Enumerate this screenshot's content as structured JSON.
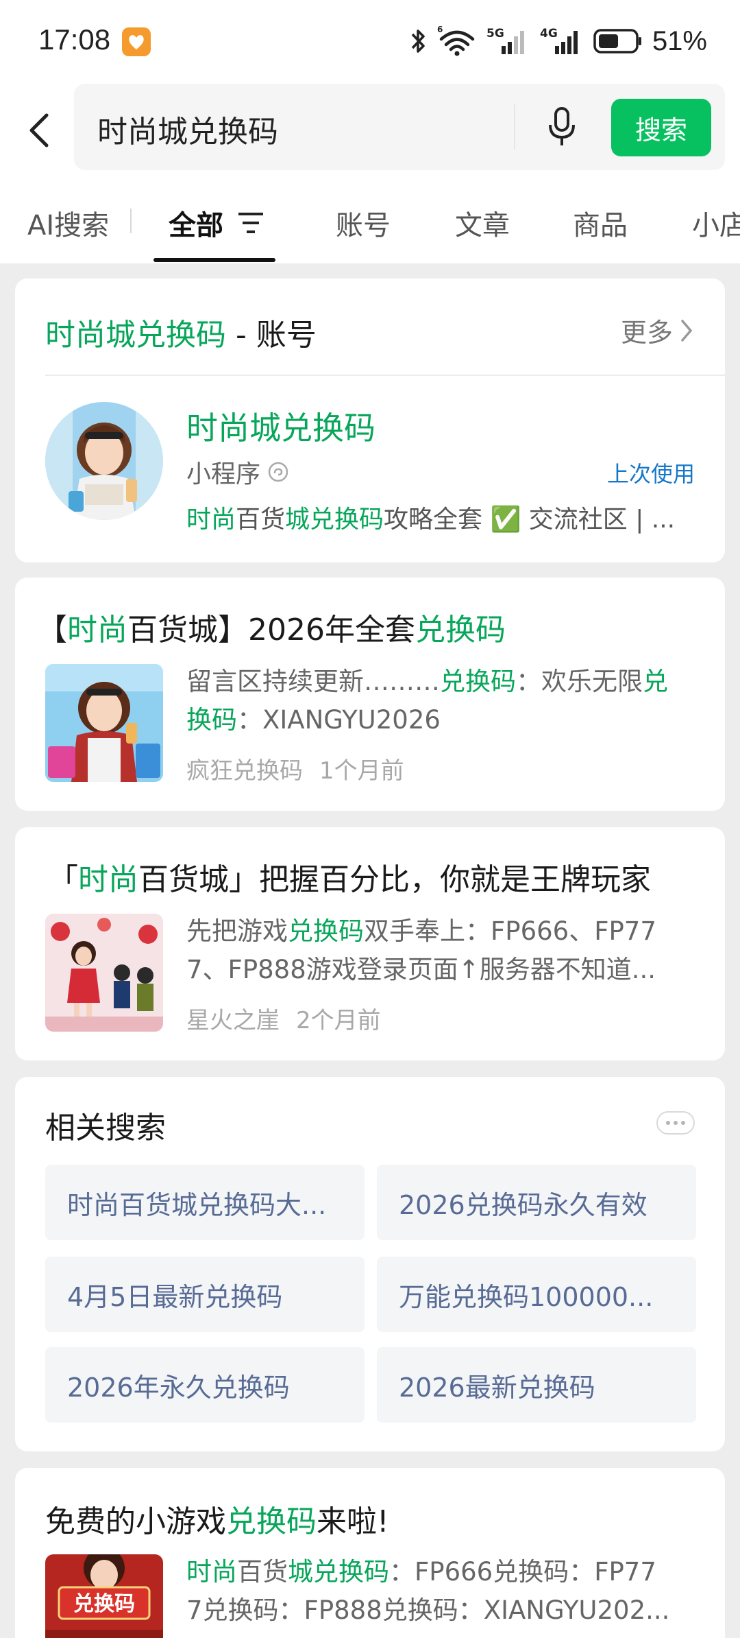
{
  "status_bar": {
    "time": "17:08",
    "network_5g": "5G",
    "network_4g": "4G",
    "wifi_badge": "6",
    "battery": "51%"
  },
  "search": {
    "query": "时尚城兑换码",
    "button": "搜索"
  },
  "tabs": [
    "AI搜索",
    "全部",
    "账号",
    "文章",
    "商品",
    "小店"
  ],
  "account_card": {
    "header_hl": "时尚城兑换码",
    "header_rest": " - 账号",
    "more": "更多",
    "name": "时尚城兑换码",
    "type": "小程序",
    "last_used": "上次使用",
    "desc_parts": [
      "时尚",
      "百货",
      "城兑换码",
      "攻略全套 ✅ 交流社区 | ..."
    ]
  },
  "results": [
    {
      "title_parts": [
        "【",
        "时尚",
        "百货城】2026年全套",
        "兑换码"
      ],
      "line1_parts": [
        "留言区持续更新………",
        "兑换码",
        "：欢乐无限",
        "兑"
      ],
      "line2_parts": [
        "换码",
        "：XIANGYU2026"
      ],
      "source": "疯狂兑换码",
      "time": "1个月前"
    },
    {
      "title_parts": [
        "「",
        "时尚",
        "百货城」把握百分比，你就是王牌玩家"
      ],
      "line1_parts": [
        "先把游戏",
        "兑换码",
        "双手奉上：FP666、FP77"
      ],
      "line2_parts": [
        "7、FP888游戏登录页面↑服务器不知道..."
      ],
      "source": "星火之崖",
      "time": "2个月前"
    },
    {
      "title_parts": [
        "免费的小游戏",
        "兑换码",
        "来啦!"
      ],
      "line1_parts": [
        "时尚",
        "百货",
        "城兑换码",
        "：FP666兑换码：FP77"
      ],
      "line2_parts": [
        "7兑换码：FP888兑换码：XIANGYU202..."
      ],
      "thumb_text": "兑换码"
    }
  ],
  "related": {
    "title": "相关搜索",
    "items": [
      "时尚百货城兑换码大...",
      "2026兑换码永久有效",
      "4月5日最新兑换码",
      "万能兑换码100000...",
      "2026年永久兑换码",
      "2026最新兑换码"
    ]
  },
  "colors": {
    "highlight": "#07a65a",
    "button": "#07c160",
    "link_blue": "#1677c9",
    "chip_text": "#576b95"
  }
}
